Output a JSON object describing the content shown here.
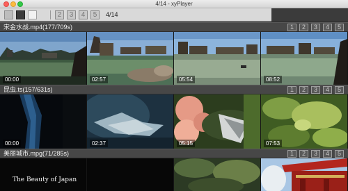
{
  "window": {
    "title": "4/14 - xyPlayer"
  },
  "toolbar": {
    "pages": [
      "2",
      "3",
      "4",
      "5"
    ],
    "page_indicator": "4/14"
  },
  "groups": [
    {
      "title": "宋金水战.mp4(177/709s)",
      "pages": [
        "1",
        "2",
        "3",
        "4",
        "5"
      ],
      "thumbs": [
        {
          "time": "00:00",
          "scene": "lake-town"
        },
        {
          "time": "02:57",
          "scene": "lake-town"
        },
        {
          "time": "05:54",
          "scene": "lake-town"
        },
        {
          "time": "08:52",
          "scene": "lake-town"
        }
      ]
    },
    {
      "title": "昆虫.ts(157/631s)",
      "pages": [
        "1",
        "2",
        "3",
        "4",
        "5"
      ],
      "thumbs": [
        {
          "time": "00:00",
          "scene": "dark-blue"
        },
        {
          "time": "02:37",
          "scene": "insect"
        },
        {
          "time": "05:15",
          "scene": "flower"
        },
        {
          "time": "07:53",
          "scene": "leaves"
        }
      ]
    },
    {
      "title": "美丽城市.mpg(71/285s)",
      "pages": [
        "1",
        "2",
        "3",
        "4",
        "5"
      ],
      "caption": "The Beauty of Japan",
      "thumbs": [
        {
          "time": "",
          "scene": "black"
        },
        {
          "time": "",
          "scene": "black"
        },
        {
          "time": "",
          "scene": "foliage"
        },
        {
          "time": "",
          "scene": "temple"
        }
      ]
    }
  ],
  "colors": {
    "accent_close": "#fc605c",
    "accent_min": "#fdbc40",
    "accent_max": "#34c84a"
  }
}
